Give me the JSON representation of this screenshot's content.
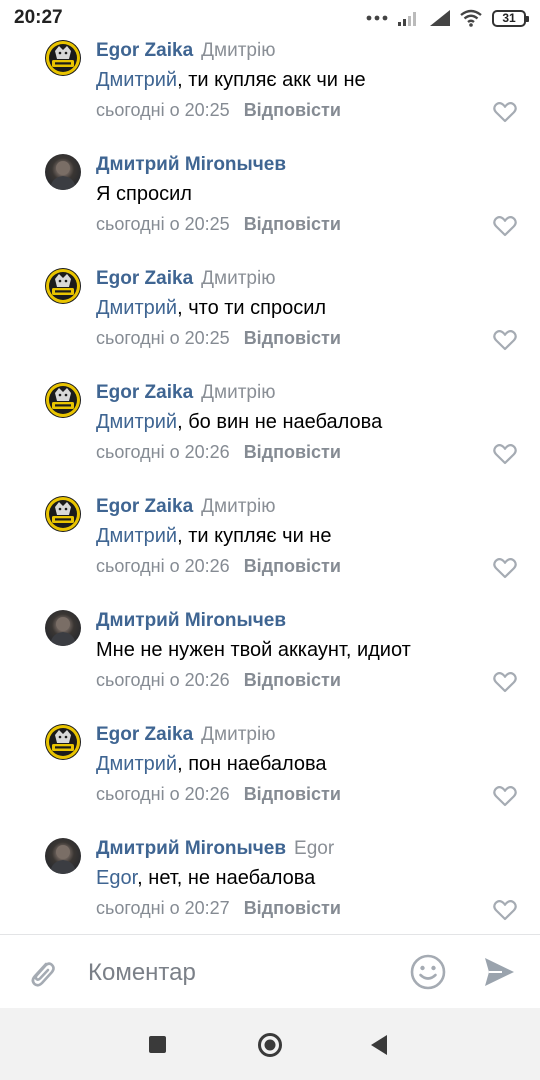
{
  "status_bar": {
    "time": "20:27",
    "battery": "31"
  },
  "comments": [
    {
      "author": "Egor Zaika",
      "reply_to": "Дмитрію",
      "mention": "Дмитрий",
      "text": ", ти купляє акк чи не",
      "time": "сьогодні о 20:25",
      "reply_label": "Відповісти",
      "avatar": "burn-logo"
    },
    {
      "author": "Дмитрий Мironычев",
      "reply_to": "",
      "mention": "",
      "text": "Я спросил",
      "time": "сьогодні о 20:25",
      "reply_label": "Відповісти",
      "avatar": "user-photo"
    },
    {
      "author": "Egor Zaika",
      "reply_to": "Дмитрію",
      "mention": "Дмитрий",
      "text": ", что ти спросил",
      "time": "сьогодні о 20:25",
      "reply_label": "Відповісти",
      "avatar": "burn-logo"
    },
    {
      "author": "Egor Zaika",
      "reply_to": "Дмитрію",
      "mention": "Дмитрий",
      "text": ",  бо вин не наебалова",
      "time": "сьогодні о 20:26",
      "reply_label": "Відповісти",
      "avatar": "burn-logo"
    },
    {
      "author": "Egor Zaika",
      "reply_to": "Дмитрію",
      "mention": "Дмитрий",
      "text": ", ти купляє чи не",
      "time": "сьогодні о 20:26",
      "reply_label": "Відповісти",
      "avatar": "burn-logo"
    },
    {
      "author": "Дмитрий Мironычев",
      "reply_to": "",
      "mention": "",
      "text": "Мне не нужен твой аккаунт, идиот",
      "time": "сьогодні о 20:26",
      "reply_label": "Відповісти",
      "avatar": "user-photo"
    },
    {
      "author": "Egor Zaika",
      "reply_to": "Дмитрію",
      "mention": "Дмитрий",
      "text": ", пон наебалова",
      "time": "сьогодні о 20:26",
      "reply_label": "Відповісти",
      "avatar": "burn-logo"
    },
    {
      "author": "Дмитрий Мironычев",
      "reply_to": "Egor",
      "mention": "Egor",
      "text": ", нет, не наебалова",
      "time": "сьогодні о 20:27",
      "reply_label": "Відповісти",
      "avatar": "user-photo"
    }
  ],
  "composer": {
    "placeholder": "Коментар",
    "value": ""
  },
  "colors": {
    "link": "#3f6592",
    "muted": "#858b93",
    "icon": "#a5abb3",
    "send_icon": "#9aa3ad",
    "burn_yellow": "#e9c400"
  },
  "icons": {
    "attach": "paperclip-icon",
    "emoji": "smiley-icon",
    "send": "send-icon",
    "like": "heart-icon",
    "nav_recent": "square-icon",
    "nav_home": "circle-icon",
    "nav_back": "triangle-back-icon"
  }
}
